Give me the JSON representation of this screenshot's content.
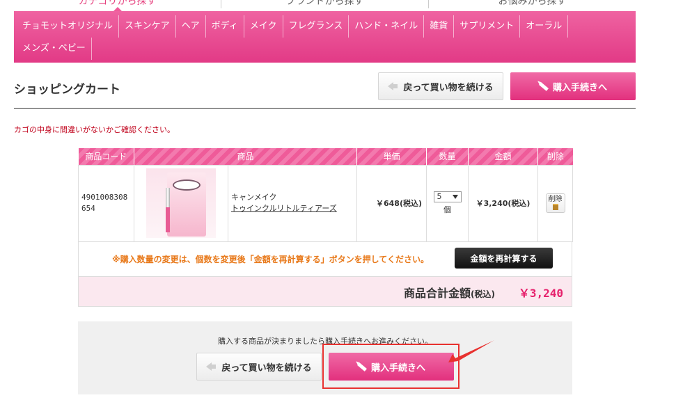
{
  "top_tabs": [
    {
      "label": "カテゴリから探す",
      "active": true
    },
    {
      "label": "ブランドから探す",
      "active": false
    },
    {
      "label": "お悩みから探す",
      "active": false
    }
  ],
  "categories": [
    "チョモットオリジナル",
    "スキンケア",
    "ヘア",
    "ボディ",
    "メイク",
    "フレグランス",
    "ハンド・ネイル",
    "雑貨",
    "サプリメント",
    "オーラル",
    "メンズ・ベビー"
  ],
  "heading": {
    "title": "ショッピングカート",
    "back_label": "戻って買い物を続ける",
    "proceed_label": "購入手続きへ"
  },
  "notice": "カゴの中身に間違いがないかご確認ください。",
  "table": {
    "headers": [
      "商品コード",
      "商品",
      "単価",
      "数量",
      "金額",
      "削除"
    ],
    "item": {
      "code": "4901008308654",
      "brand": "キャンメイク",
      "name": "トゥインクルリトルティアーズ",
      "unit_price": "￥648(税込)",
      "quantity": "5",
      "quantity_unit": "個",
      "amount": "￥3,240(税込)",
      "delete_label": "削除"
    }
  },
  "recalc": {
    "message": "※購入数量の変更は、個数を変更後「金額を再計算する」ボタンを押してください。",
    "button_label": "金額を再計算する"
  },
  "total": {
    "label": "商品合計金額",
    "tax_note": "(税込)",
    "value": "￥3,240"
  },
  "bottom": {
    "message": "購入する商品が決まりましたら購入手続きへお進みください。",
    "back_label": "戻って買い物を続ける",
    "proceed_label": "購入手続きへ"
  },
  "colors": {
    "brand_pink": "#e6427f",
    "highlight_red": "#e8312f",
    "notice_red": "#c0001a",
    "recalc_orange": "#e8791a"
  }
}
